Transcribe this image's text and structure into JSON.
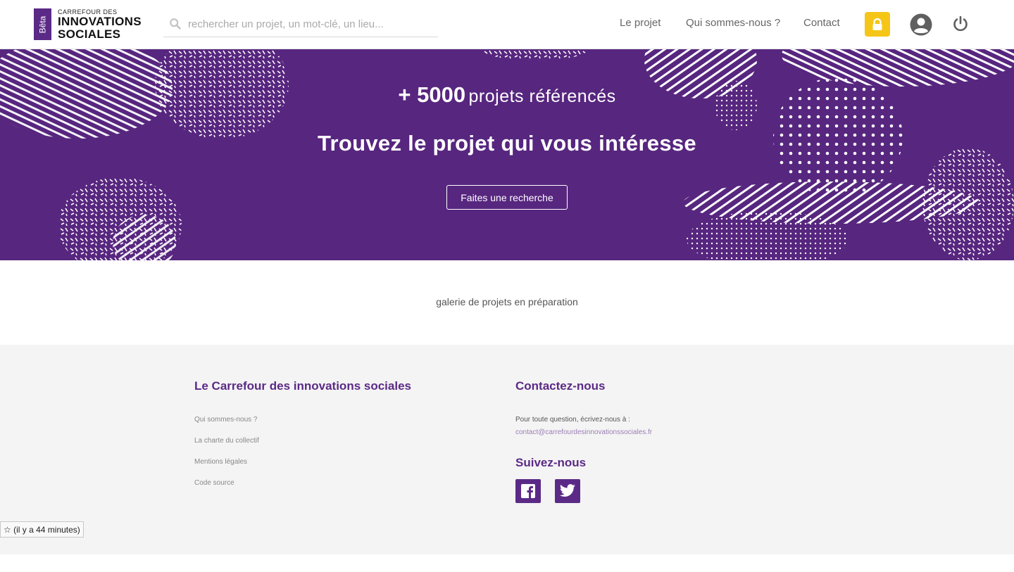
{
  "logo": {
    "badge": "Bêta",
    "line1": "CARREFOUR DES",
    "line2": "INNOVATIONS",
    "line3": "SOCIALES"
  },
  "search": {
    "placeholder": "rechercher un projet, un mot-clé, un lieu..."
  },
  "nav": {
    "items": [
      "Le projet",
      "Qui sommes-nous ?",
      "Contact"
    ]
  },
  "colors": {
    "brand_purple": "#57267f",
    "lock_yellow": "#f5c518",
    "footer_bg": "#f4f4f4"
  },
  "icons": [
    "search-icon",
    "lock-icon",
    "user-icon",
    "power-icon",
    "facebook-icon",
    "twitter-icon"
  ],
  "hero": {
    "count": "+ 5000",
    "count_suffix": "projets référencés",
    "title": "Trouvez le projet qui vous intéresse",
    "button": "Faites une recherche"
  },
  "main": {
    "gallery_message": "galerie de projets en préparation"
  },
  "footer": {
    "col1": {
      "heading": "Le Carrefour des innovations sociales",
      "links": [
        "Qui sommes-nous ?",
        "La charte du collectif",
        "Mentions légales",
        "Code source"
      ]
    },
    "col2": {
      "heading": "Contactez-nous",
      "question": "Pour toute question, écrivez-nous à :",
      "email": "contact@carrefourdesinnovationssociales.fr",
      "follow_heading": "Suivez-nous"
    }
  },
  "timestamp": "☆ (il y a 44 minutes)"
}
